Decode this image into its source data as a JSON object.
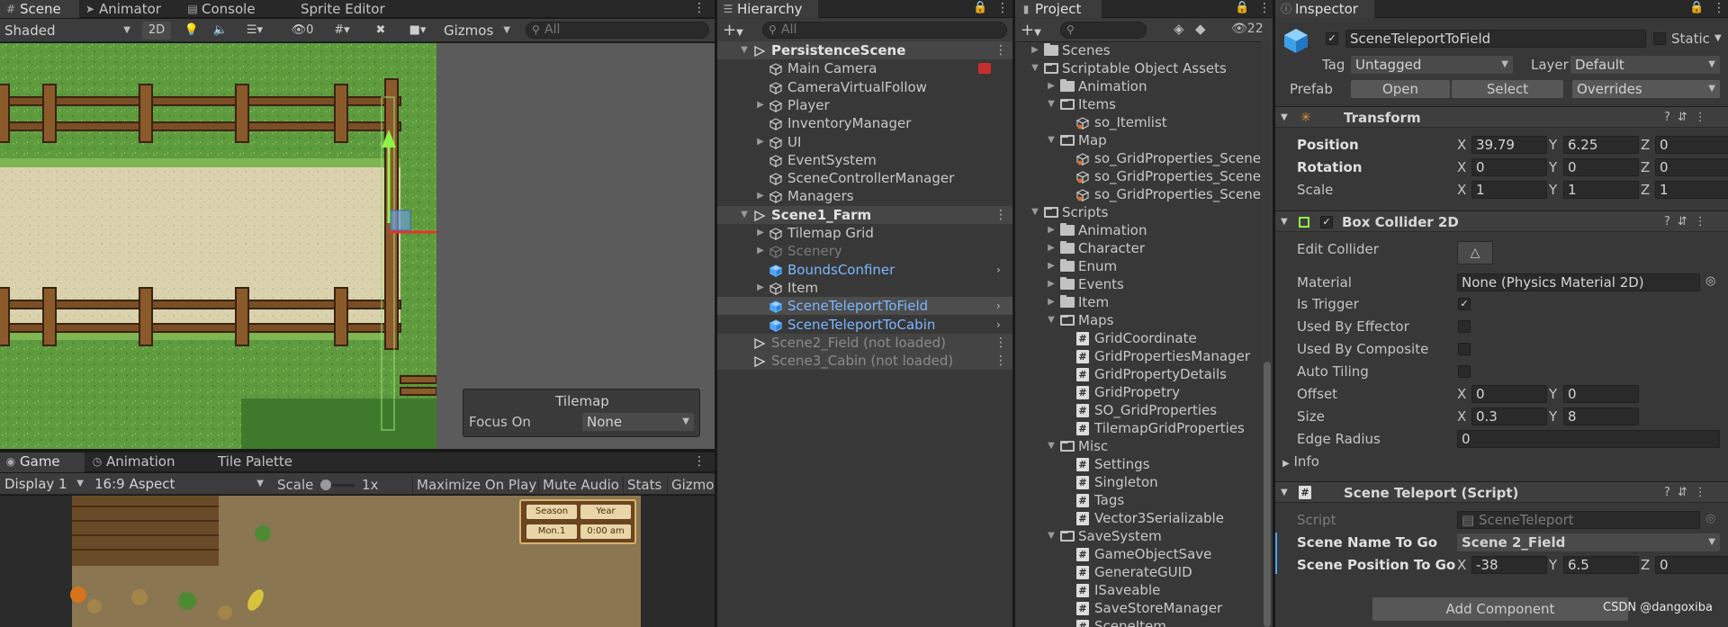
{
  "scene_panel": {
    "tabs": [
      {
        "label": "Scene",
        "icon": "grid-icon"
      },
      {
        "label": "Animator",
        "icon": "animator-icon"
      },
      {
        "label": "Console",
        "icon": "console-icon"
      },
      {
        "label": "Sprite Editor",
        "icon": ""
      }
    ],
    "shading": "Shaded",
    "mode_2d": "2D",
    "hidden_count": "0",
    "gizmos": "Gizmos",
    "search_placeholder": "All",
    "tilemap_overlay": {
      "title": "Tilemap",
      "focus_label": "Focus On",
      "focus_value": "None"
    }
  },
  "game_panel": {
    "tabs": [
      {
        "label": "Game",
        "icon": "gamepad-icon"
      },
      {
        "label": "Animation",
        "icon": "animation-icon"
      },
      {
        "label": "Tile Palette",
        "icon": ""
      }
    ],
    "display": "Display 1",
    "aspect": "16:9 Aspect",
    "scale_label": "Scale",
    "scale_value": "1x",
    "maximize": "Maximize On Play",
    "mute": "Mute Audio",
    "stats": "Stats",
    "gizmos": "Gizmo",
    "hud": {
      "season": "Season",
      "year": "Year",
      "day": "Mon.1",
      "time": "0:00 am"
    }
  },
  "hierarchy": {
    "title": "Hierarchy",
    "search_placeholder": "All",
    "rows": [
      {
        "label": "PersistenceScene",
        "kind": "scene",
        "depth": 0,
        "fold": "open"
      },
      {
        "label": "Main Camera",
        "kind": "go",
        "depth": 1,
        "fold": ""
      },
      {
        "label": "CameraVirtualFollow",
        "kind": "go",
        "depth": 1,
        "fold": ""
      },
      {
        "label": "Player",
        "kind": "go",
        "depth": 1,
        "fold": "closed"
      },
      {
        "label": "InventoryManager",
        "kind": "go",
        "depth": 1,
        "fold": ""
      },
      {
        "label": "UI",
        "kind": "go",
        "depth": 1,
        "fold": "closed"
      },
      {
        "label": "EventSystem",
        "kind": "go",
        "depth": 1,
        "fold": ""
      },
      {
        "label": "SceneControllerManager",
        "kind": "go",
        "depth": 1,
        "fold": ""
      },
      {
        "label": "Managers",
        "kind": "go",
        "depth": 1,
        "fold": "closed"
      },
      {
        "label": "Scene1_Farm",
        "kind": "scene",
        "depth": 0,
        "fold": "open"
      },
      {
        "label": "Tilemap Grid",
        "kind": "go",
        "depth": 1,
        "fold": "closed"
      },
      {
        "label": "Scenery",
        "kind": "go-disabled",
        "depth": 1,
        "fold": "closed"
      },
      {
        "label": "BoundsConfiner",
        "kind": "prefab",
        "depth": 1,
        "fold": ""
      },
      {
        "label": "Item",
        "kind": "go",
        "depth": 1,
        "fold": "closed"
      },
      {
        "label": "SceneTeleportToField",
        "kind": "prefab",
        "depth": 1,
        "fold": ""
      },
      {
        "label": "SceneTeleportToCabin",
        "kind": "prefab",
        "depth": 1,
        "fold": ""
      },
      {
        "label": "Scene2_Field (not loaded)",
        "kind": "scene-unloaded",
        "depth": 0,
        "fold": ""
      },
      {
        "label": "Scene3_Cabin (not loaded)",
        "kind": "scene-unloaded",
        "depth": 0,
        "fold": ""
      }
    ]
  },
  "project": {
    "title": "Project",
    "hidden_count": "22",
    "rows": [
      {
        "label": "Scenes",
        "kind": "folder",
        "depth": 0,
        "fold": "closed"
      },
      {
        "label": "Scriptable Object Assets",
        "kind": "folder-open",
        "depth": 0,
        "fold": "open"
      },
      {
        "label": "Animation",
        "kind": "folder",
        "depth": 1,
        "fold": "closed"
      },
      {
        "label": "Items",
        "kind": "folder-open",
        "depth": 1,
        "fold": "open"
      },
      {
        "label": "so_Itemlist",
        "kind": "asset",
        "depth": 2,
        "fold": ""
      },
      {
        "label": "Map",
        "kind": "folder-open",
        "depth": 1,
        "fold": "open"
      },
      {
        "label": "so_GridProperties_Scene",
        "kind": "asset",
        "depth": 2,
        "fold": ""
      },
      {
        "label": "so_GridProperties_Scene",
        "kind": "asset",
        "depth": 2,
        "fold": ""
      },
      {
        "label": "so_GridProperties_Scene",
        "kind": "asset",
        "depth": 2,
        "fold": ""
      },
      {
        "label": "Scripts",
        "kind": "folder-open",
        "depth": 0,
        "fold": "open"
      },
      {
        "label": "Animation",
        "kind": "folder",
        "depth": 1,
        "fold": "closed"
      },
      {
        "label": "Character",
        "kind": "folder",
        "depth": 1,
        "fold": "closed"
      },
      {
        "label": "Enum",
        "kind": "folder",
        "depth": 1,
        "fold": "closed"
      },
      {
        "label": "Events",
        "kind": "folder",
        "depth": 1,
        "fold": "closed"
      },
      {
        "label": "Item",
        "kind": "folder",
        "depth": 1,
        "fold": "closed"
      },
      {
        "label": "Maps",
        "kind": "folder-open",
        "depth": 1,
        "fold": "open"
      },
      {
        "label": "GridCoordinate",
        "kind": "script",
        "depth": 2,
        "fold": ""
      },
      {
        "label": "GridPropertiesManager",
        "kind": "script",
        "depth": 2,
        "fold": ""
      },
      {
        "label": "GridPropertyDetails",
        "kind": "script",
        "depth": 2,
        "fold": ""
      },
      {
        "label": "GridPropetry",
        "kind": "script",
        "depth": 2,
        "fold": ""
      },
      {
        "label": "SO_GridProperties",
        "kind": "script",
        "depth": 2,
        "fold": ""
      },
      {
        "label": "TilemapGridProperties",
        "kind": "script",
        "depth": 2,
        "fold": ""
      },
      {
        "label": "Misc",
        "kind": "folder-open",
        "depth": 1,
        "fold": "open"
      },
      {
        "label": "Settings",
        "kind": "script",
        "depth": 2,
        "fold": ""
      },
      {
        "label": "Singleton",
        "kind": "script",
        "depth": 2,
        "fold": ""
      },
      {
        "label": "Tags",
        "kind": "script",
        "depth": 2,
        "fold": ""
      },
      {
        "label": "Vector3Serializable",
        "kind": "script",
        "depth": 2,
        "fold": ""
      },
      {
        "label": "SaveSystem",
        "kind": "folder-open",
        "depth": 1,
        "fold": "open"
      },
      {
        "label": "GameObjectSave",
        "kind": "script",
        "depth": 2,
        "fold": ""
      },
      {
        "label": "GenerateGUID",
        "kind": "script",
        "depth": 2,
        "fold": ""
      },
      {
        "label": "ISaveable",
        "kind": "script",
        "depth": 2,
        "fold": ""
      },
      {
        "label": "SaveStoreManager",
        "kind": "script",
        "depth": 2,
        "fold": ""
      },
      {
        "label": "SceneItem",
        "kind": "script",
        "depth": 2,
        "fold": ""
      }
    ]
  },
  "inspector": {
    "title": "Inspector",
    "object_name": "SceneTeleportToField",
    "static_label": "Static",
    "tag_label": "Tag",
    "tag_value": "Untagged",
    "layer_label": "Layer",
    "layer_value": "Default",
    "prefab_label": "Prefab",
    "open": "Open",
    "select": "Select",
    "overrides": "Overrides",
    "transform": {
      "title": "Transform",
      "position_label": "Position",
      "position": {
        "x": "39.79",
        "y": "6.25",
        "z": "0"
      },
      "rotation_label": "Rotation",
      "rotation": {
        "x": "0",
        "y": "0",
        "z": "0"
      },
      "scale_label": "Scale",
      "scale": {
        "x": "1",
        "y": "1",
        "z": "1"
      }
    },
    "box_collider": {
      "title": "Box Collider 2D",
      "edit_collider": "Edit Collider",
      "material_label": "Material",
      "material": "None (Physics Material 2D)",
      "is_trigger": "Is Trigger",
      "used_by_effector": "Used By Effector",
      "used_by_composite": "Used By Composite",
      "auto_tiling": "Auto Tiling",
      "offset_label": "Offset",
      "offset": {
        "x": "0",
        "y": "0"
      },
      "size_label": "Size",
      "size": {
        "x": "0.3",
        "y": "8"
      },
      "edge_radius_label": "Edge Radius",
      "edge_radius": "0",
      "info": "Info"
    },
    "scene_teleport": {
      "title": "Scene Teleport (Script)",
      "script_label": "Script",
      "script_value": "SceneTeleport",
      "scene_name_label": "Scene Name To Go",
      "scene_name": "Scene 2_Field",
      "scene_pos_label": "Scene Position To Go",
      "scene_pos": {
        "x": "-38",
        "y": "6.5",
        "z": "0"
      }
    },
    "add_component": "Add Component"
  },
  "axis_labels": {
    "x": "X",
    "y": "Y",
    "z": "Z"
  },
  "watermark": "CSDN @dangoxiba",
  "colors": {
    "accent_blue": "#4aa3ff",
    "prefab_blue": "#7cb6ff",
    "panel_bg": "#383838",
    "selection": "#4d4d4d"
  }
}
